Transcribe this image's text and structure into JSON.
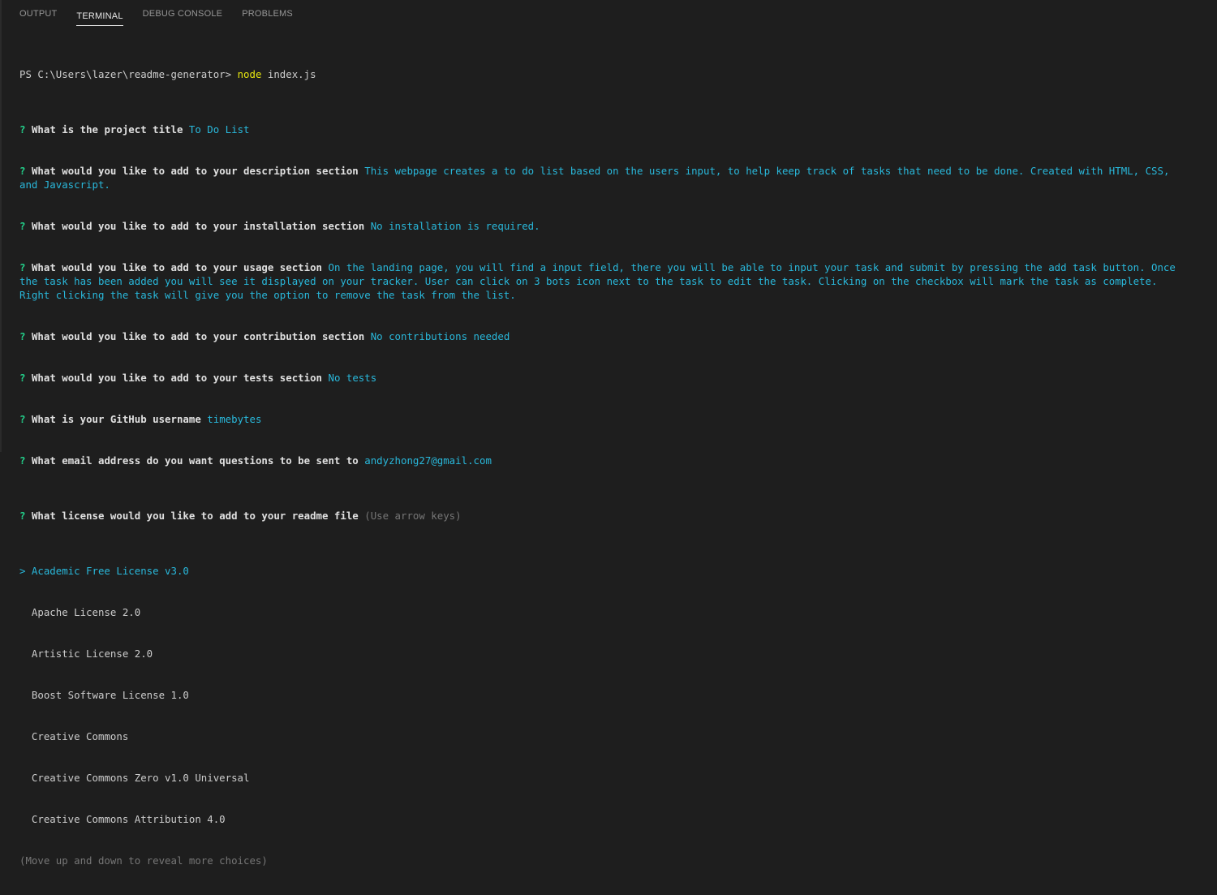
{
  "tabs": [
    {
      "label": "OUTPUT",
      "active": false
    },
    {
      "label": "TERMINAL",
      "active": true
    },
    {
      "label": "DEBUG CONSOLE",
      "active": false
    },
    {
      "label": "PROBLEMS",
      "active": false
    }
  ],
  "terminal": {
    "prompt_prefix": "PS C:\\Users\\lazer\\readme-generator> ",
    "command": "node",
    "command_args": " index.js",
    "questions": [
      {
        "mark": "?",
        "text": "What is the project title",
        "answer": "To Do List"
      },
      {
        "mark": "?",
        "text": "What would you like to add to your description section",
        "answer": "This webpage creates a to do list based on the users input, to help keep track of tasks that need to be done. Created with HTML, CSS, and Javascript."
      },
      {
        "mark": "?",
        "text": "What would you like to add to your installation section",
        "answer": "No installation is required."
      },
      {
        "mark": "?",
        "text": "What would you like to add to your usage section",
        "answer": "On the landing page, you will find a input field, there you will be able to input your task and submit by pressing the add task button. Once the task has been added you will see it displayed on your tracker. User can click on 3 bots icon next to the task to edit the task. Clicking on the checkbox will mark the task as complete. Right clicking the task will give you the option to remove the task from the list."
      },
      {
        "mark": "?",
        "text": "What would you like to add to your contribution section",
        "answer": "No contributions needed"
      },
      {
        "mark": "?",
        "text": "What would you like to add to your tests section",
        "answer": "No tests"
      },
      {
        "mark": "?",
        "text": "What is your GitHub username",
        "answer": "timebytes"
      },
      {
        "mark": "?",
        "text": "What email address do you want questions to be sent to",
        "answer": "andyzhong27@gmail.com"
      }
    ],
    "license_question": {
      "mark": "?",
      "text": "What license would you like to add to your readme file",
      "hint": "(Use arrow keys)"
    },
    "selected_choice": "> Academic Free License v3.0",
    "choices": [
      "  Apache License 2.0",
      "  Artistic License 2.0",
      "  Boost Software License 1.0",
      "  Creative Commons",
      "  Creative Commons Zero v1.0 Universal",
      "  Creative Commons Attribution 4.0"
    ],
    "footer_hint": "(Move up and down to reveal more choices)"
  },
  "colors": {
    "background": "#1e1e1e",
    "question_mark": "#23d18b",
    "answer": "#29b8db",
    "command": "#e5e510",
    "hint": "#767676"
  }
}
